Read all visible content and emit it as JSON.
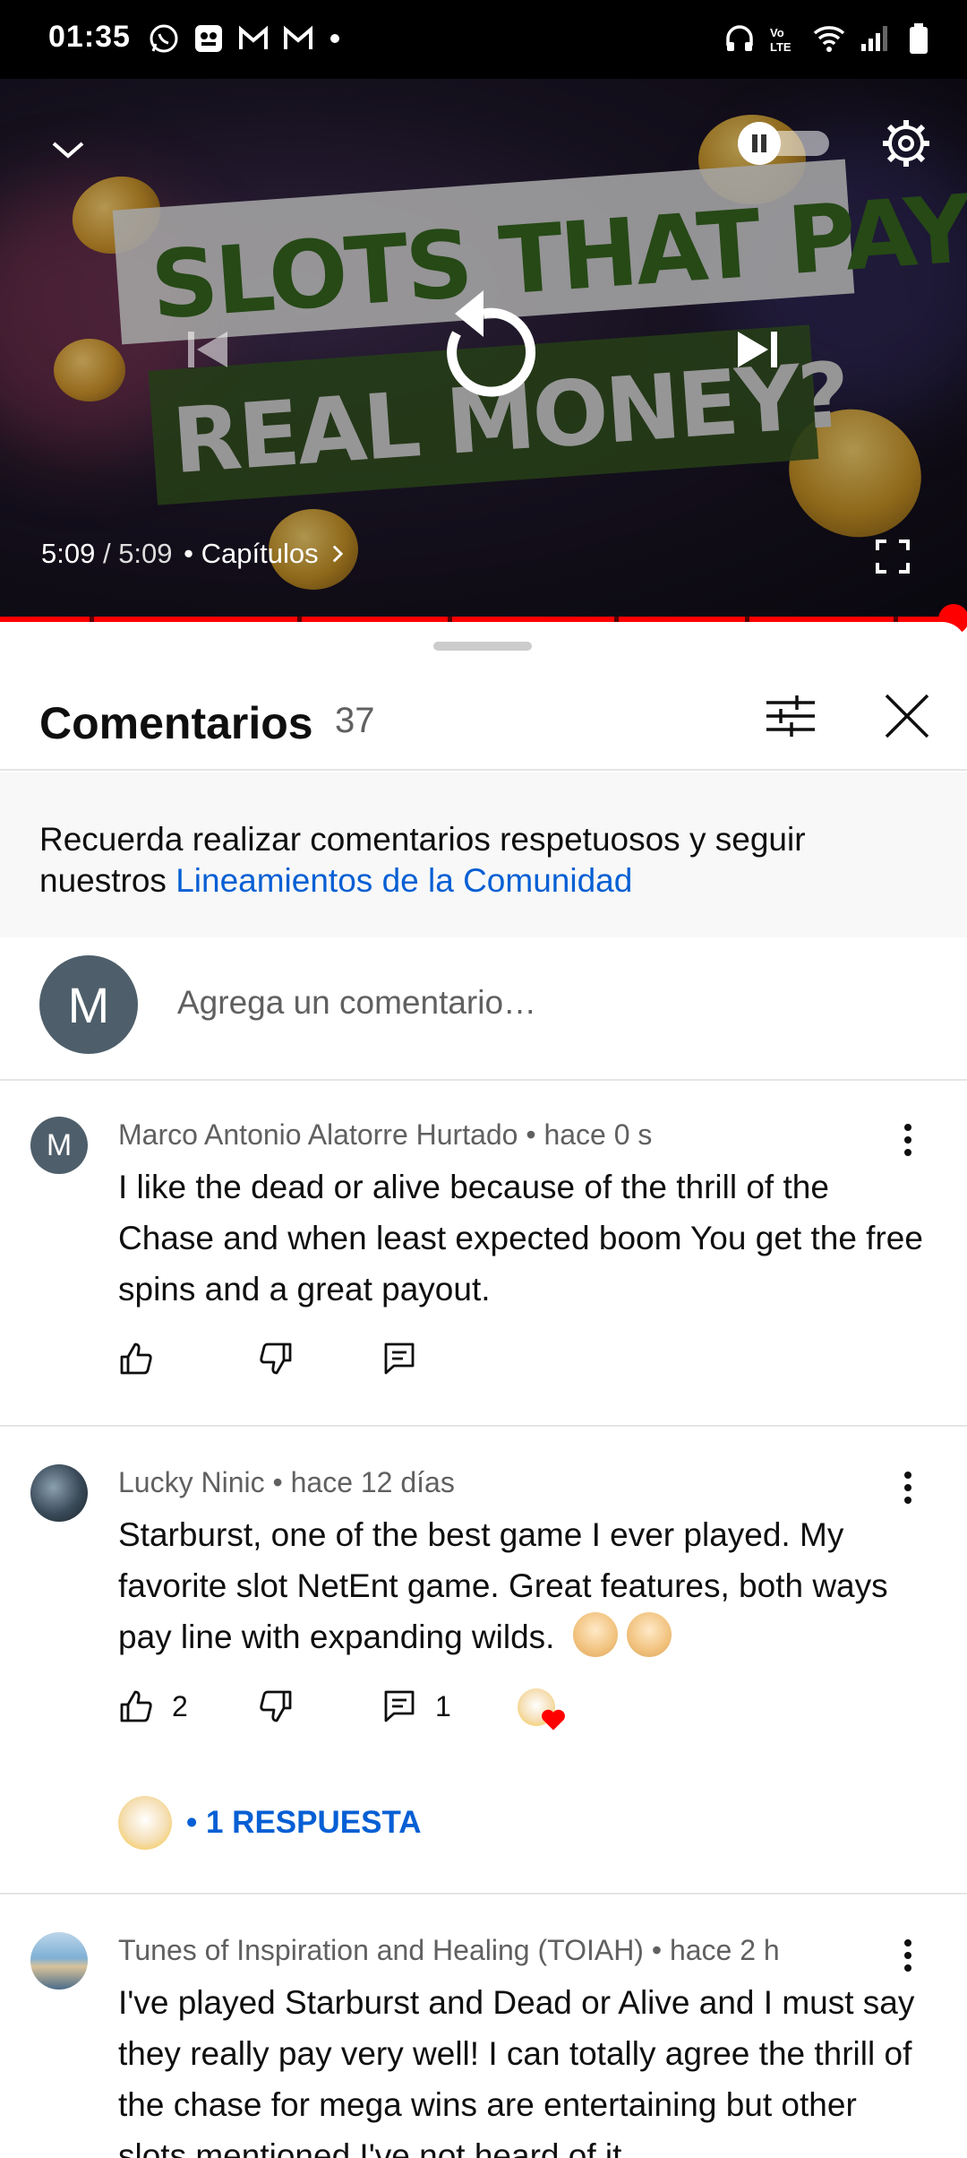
{
  "status_bar": {
    "time": "01:35",
    "left_icons": [
      "whatsapp-icon",
      "app-icon",
      "gmail-icon",
      "gmail-icon",
      "dot"
    ],
    "right_icons": [
      "headphones-icon",
      "volte-icon",
      "wifi-icon",
      "signal-icon",
      "battery-icon"
    ]
  },
  "player": {
    "thumbnail_line1": "SLOTS THAT PAY",
    "thumbnail_line2": "REAL MONEY?",
    "time_current": "5:09",
    "time_separator": " / ",
    "time_total": "5:09",
    "chapters_label": "• Capítulos",
    "progress": 1.0,
    "accent_color": "#ff0000"
  },
  "comments_panel": {
    "title": "Comentarios",
    "count": "37",
    "notice_text": "Recuerda realizar comentarios respetuosos y seguir nuestros ",
    "notice_link": "Lineamientos de la Comunidad",
    "add_comment_avatar": "M",
    "add_comment_placeholder": "Agrega un comentario…",
    "comments": [
      {
        "avatar_letter": "M",
        "author_meta": "Marco Antonio Alatorre Hurtado • hace 0 s",
        "text": "I like the dead or alive because of the thrill of the Chase and when least expected boom You get the free spins and a great payout.",
        "likes": "",
        "replies_count": ""
      },
      {
        "avatar_letter": "",
        "author_meta": "Lucky Ninic • hace 12 días",
        "text": "Starburst, one of the best game I ever played. My favorite slot NetEnt game. Great features, both ways pay line with expanding wilds.",
        "likes": "2",
        "replies_count": "1",
        "replies_link": "• 1 RESPUESTA"
      },
      {
        "avatar_letter": "",
        "author_meta": "Tunes of Inspiration and Healing (TOIAH) • hace 2 h",
        "text": "I've played Starburst and Dead or Alive and I must say they really pay very well! I can totally agree the thrill of the chase for mega wins are entertaining but other slots mentioned I've not heard of it"
      }
    ]
  }
}
